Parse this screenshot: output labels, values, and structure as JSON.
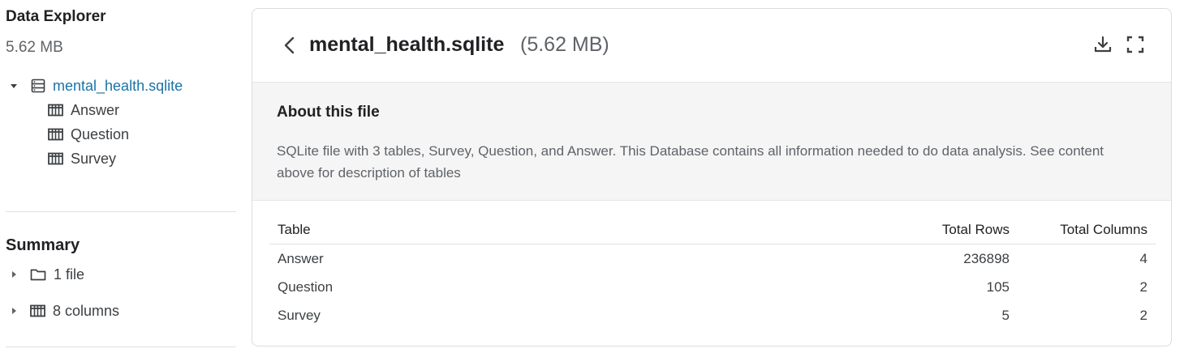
{
  "sidebar": {
    "title": "Data Explorer",
    "size": "5.62 MB",
    "database": {
      "name": "mental_health.sqlite",
      "icon": "database-icon",
      "expanded": true,
      "tables": [
        {
          "label": "Answer",
          "icon": "table-icon"
        },
        {
          "label": "Question",
          "icon": "table-icon"
        },
        {
          "label": "Survey",
          "icon": "table-icon"
        }
      ]
    },
    "summary": {
      "title": "Summary",
      "items": [
        {
          "label": "1 file",
          "icon": "folder-icon"
        },
        {
          "label": "8 columns",
          "icon": "columns-icon"
        }
      ]
    }
  },
  "main": {
    "file_name": "mental_health.sqlite",
    "file_size": "(5.62 MB)",
    "actions": [
      "download-icon",
      "fullscreen-icon"
    ],
    "about": {
      "title": "About this file",
      "text": "SQLite file with 3 tables, Survey, Question, and Answer. This Database contains all information needed to do data analysis. See content above for description of tables"
    },
    "table": {
      "headers": [
        "Table",
        "Total Rows",
        "Total Columns"
      ],
      "rows": [
        [
          "Answer",
          "236898",
          "4"
        ],
        [
          "Question",
          "105",
          "2"
        ],
        [
          "Survey",
          "5",
          "2"
        ]
      ]
    }
  },
  "colors": {
    "link": "#1a73a8",
    "muted": "#5f6368",
    "panel_bg": "#f5f5f5",
    "border": "#dadce0"
  }
}
